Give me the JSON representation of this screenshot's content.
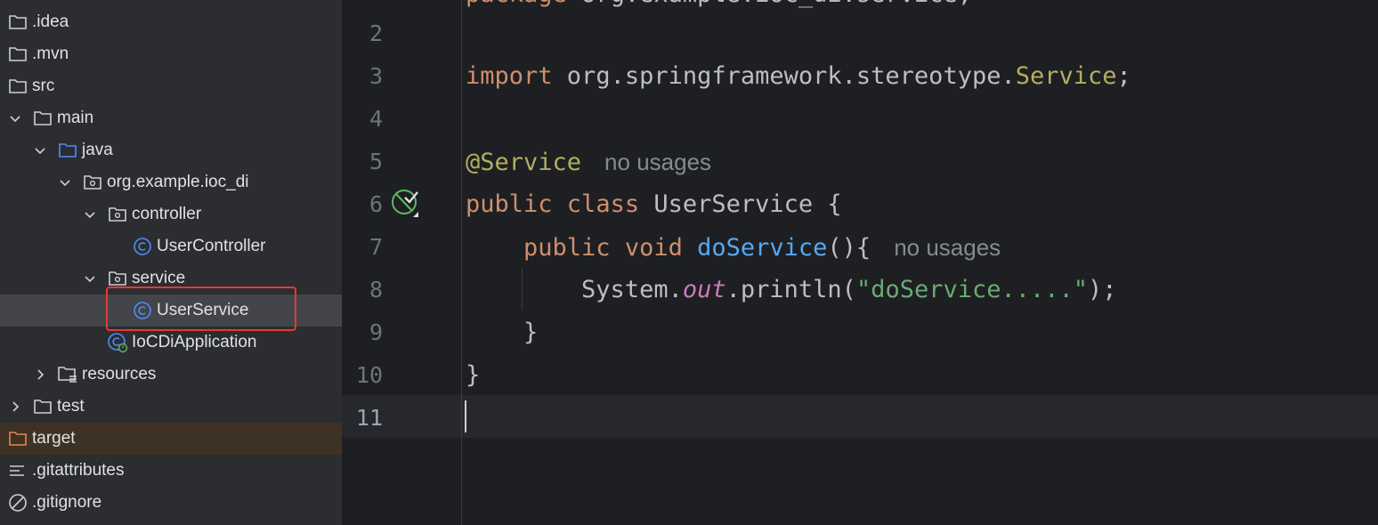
{
  "tree": {
    "items": [
      {
        "label": ".idea",
        "icon": "folder-icon"
      },
      {
        "label": ".mvn",
        "icon": "folder-icon"
      },
      {
        "label": "src",
        "icon": "folder-icon"
      },
      {
        "label": "main",
        "icon": "folder-icon"
      },
      {
        "label": "java",
        "icon": "source-folder-icon"
      },
      {
        "label": "org.example.ioc_di",
        "icon": "package-icon"
      },
      {
        "label": "controller",
        "icon": "package-icon"
      },
      {
        "label": "UserController",
        "icon": "java-class-icon"
      },
      {
        "label": "service",
        "icon": "package-icon"
      },
      {
        "label": "UserService",
        "icon": "java-class-icon"
      },
      {
        "label": "IoCDiApplication",
        "icon": "spring-boot-class-icon"
      },
      {
        "label": "resources",
        "icon": "resources-folder-icon"
      },
      {
        "label": "test",
        "icon": "folder-icon"
      },
      {
        "label": "target",
        "icon": "excluded-folder-icon"
      },
      {
        "label": ".gitattributes",
        "icon": "text-file-icon"
      },
      {
        "label": ".gitignore",
        "icon": "ignore-file-icon"
      }
    ],
    "selected": "UserService"
  },
  "editor": {
    "line_numbers": [
      "2",
      "3",
      "4",
      "5",
      "6",
      "7",
      "8",
      "9",
      "10",
      "11"
    ],
    "current_line": "11",
    "code": {
      "l3_kw": "import",
      "l3_pkg": " org.springframework.stereotype.",
      "l3_cls": "Service",
      "l3_end": ";",
      "l5_ann": "@Service",
      "l5_hint": "no usages",
      "l6_kw1": "public",
      "l6_kw2": " class",
      "l6_name": " UserService {",
      "l7_indent": "    ",
      "l7_kw1": "public",
      "l7_kw2": " void",
      "l7_fn": " doService",
      "l7_rest": "(){",
      "l7_hint": "no usages",
      "l8_indent": "        ",
      "l8_sys": "System.",
      "l8_out": "out",
      "l8_call": ".println(",
      "l8_str": "\"doService.....\"",
      "l8_end": ");",
      "l9": "    }",
      "l10": "}"
    }
  },
  "colors": {
    "keyword": "#cf8e6d",
    "annotation": "#b3ae60",
    "method": "#56a8f5",
    "string": "#6aab73",
    "static_field": "#c77dbb",
    "highlight_box": "#e53935"
  }
}
